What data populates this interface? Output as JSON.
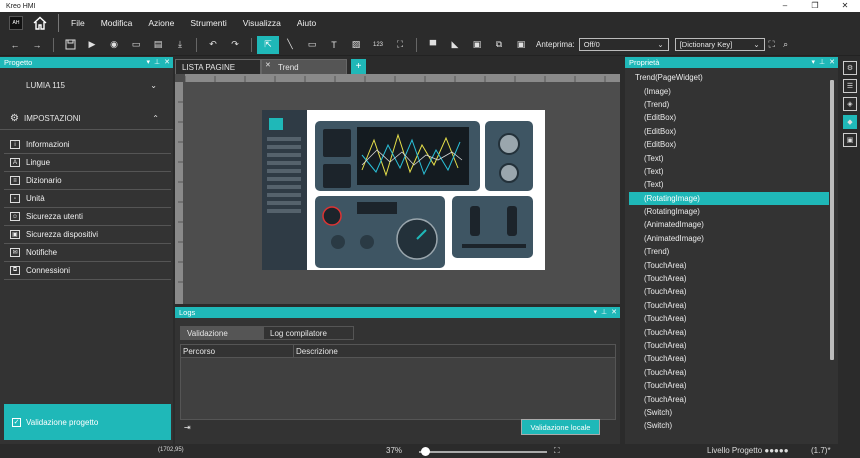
{
  "window": {
    "title": "Kreo HMI",
    "controls": [
      "–",
      "❐",
      "✕"
    ]
  },
  "menubar": {
    "logo": "AH",
    "items": [
      "File",
      "Modifica",
      "Azione",
      "Strumenti",
      "Visualizza",
      "Aiuto"
    ]
  },
  "toolbar": {
    "preview_label": "Anteprima:",
    "preview_value": "Off/0",
    "dictionary_value": "[Dictionary Key]",
    "counter_text": "123"
  },
  "left_panel": {
    "title": "Progetto",
    "project_name": "LUMIA 115",
    "section_title": "IMPOSTAZIONI",
    "items": [
      "Informazioni",
      "Lingue",
      "Dizionario",
      "Unità",
      "Sicurezza utenti",
      "Sicurezza dispositivi",
      "Notifiche",
      "Connessioni"
    ],
    "validation_label": "Validazione progetto"
  },
  "editor": {
    "tabs": [
      {
        "label": "LISTA PAGINE"
      },
      {
        "label": "Trend"
      }
    ],
    "add_tab": "+"
  },
  "logs": {
    "title": "Logs",
    "tabs": [
      "Validazione",
      "Log compilatore"
    ],
    "columns": [
      "Percorso",
      "Descrizione"
    ],
    "local_button": "Validazione locale"
  },
  "properties": {
    "title": "Proprietà",
    "root": "Trend(PageWidget)",
    "items": [
      "(Image)",
      "(Trend)",
      "(EditBox)",
      "(EditBox)",
      "(EditBox)",
      "(Text)",
      "(Text)",
      "(Text)",
      "(RotatingImage)",
      "(RotatingImage)",
      "(AnimatedImage)",
      "(AnimatedImage)",
      "(Trend)",
      "(TouchArea)",
      "(TouchArea)",
      "(TouchArea)",
      "(TouchArea)",
      "(TouchArea)",
      "(TouchArea)",
      "(TouchArea)",
      "(TouchArea)",
      "(TouchArea)",
      "(TouchArea)",
      "(TouchArea)",
      "(Switch)",
      "(Switch)"
    ],
    "selected": "(RotatingImage)"
  },
  "status": {
    "coords": "(1702,95)",
    "zoom": "37%",
    "level": "Livello Progetto ●●●●●",
    "version": "(1.7)*"
  },
  "colors": {
    "accent": "#1fb8b8",
    "bg": "#2b2b2b"
  }
}
